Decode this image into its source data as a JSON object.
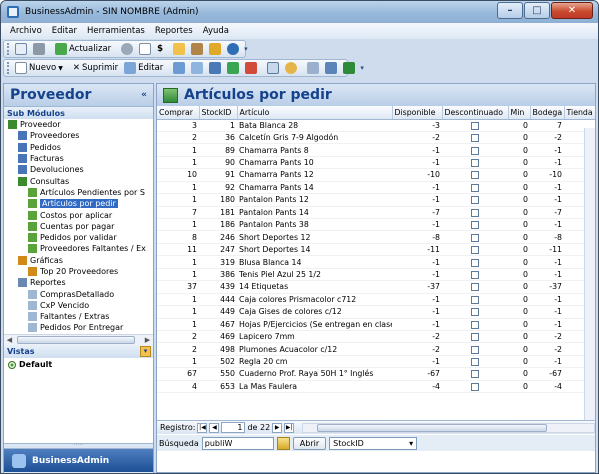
{
  "window": {
    "title": "BusinessAdmin - SIN NOMBRE (Admin)"
  },
  "menu": [
    "Archivo",
    "Editar",
    "Herramientas",
    "Reportes",
    "Ayuda"
  ],
  "toolbar1": {
    "actualizar": "Actualizar",
    "currency": "$"
  },
  "toolbar2": {
    "nuevo": "Nuevo",
    "suprimir": "Suprimir",
    "editar": "Editar"
  },
  "left": {
    "title": "Proveedor",
    "sub": "Sub Módulos",
    "tree": [
      {
        "label": "Proveedor",
        "level": 0,
        "color": "#3b8a2e"
      },
      {
        "label": "Proveedores",
        "level": 1,
        "color": "#4a74b8"
      },
      {
        "label": "Pedidos",
        "level": 1,
        "color": "#4a74b8"
      },
      {
        "label": "Facturas",
        "level": 1,
        "color": "#4a74b8"
      },
      {
        "label": "Devoluciones",
        "level": 1,
        "color": "#4a74b8"
      },
      {
        "label": "Consultas",
        "level": 1,
        "color": "#3b8a2e"
      },
      {
        "label": "Artículos Pendientes por S",
        "level": 2,
        "color": "#5aa33a"
      },
      {
        "label": "Artículos por pedir",
        "level": 2,
        "color": "#5aa33a",
        "selected": true
      },
      {
        "label": "Costos por aplicar",
        "level": 2,
        "color": "#5aa33a"
      },
      {
        "label": "Cuentas por pagar",
        "level": 2,
        "color": "#5aa33a"
      },
      {
        "label": "Pedidos por validar",
        "level": 2,
        "color": "#5aa33a"
      },
      {
        "label": "Proveedores Faltantes / Ex",
        "level": 2,
        "color": "#5aa33a"
      },
      {
        "label": "Gráficas",
        "level": 1,
        "color": "#d08a1a"
      },
      {
        "label": "Top 20 Proveedores",
        "level": 2,
        "color": "#d08a1a"
      },
      {
        "label": "Reportes",
        "level": 1,
        "color": "#6b88b0"
      },
      {
        "label": "ComprasDetallado",
        "level": 2,
        "color": "#9fb7d3"
      },
      {
        "label": "CxP Vencido",
        "level": 2,
        "color": "#9fb7d3"
      },
      {
        "label": "Faltantes / Extras",
        "level": 2,
        "color": "#9fb7d3"
      },
      {
        "label": "Pedidos Por Entregar",
        "level": 2,
        "color": "#9fb7d3"
      }
    ],
    "vistas": "Vistas",
    "vista_default": "Default",
    "nav": "BusinessAdmin"
  },
  "main": {
    "title": "Artículos por pedir",
    "columns": [
      "Comprar",
      "StockID",
      "Artículo",
      "Disponible",
      "Descontinuado",
      "Min",
      "Bodega",
      "Tienda"
    ],
    "rows": [
      [
        "3",
        "1",
        "Bata Blanca 28",
        "-3",
        "0",
        "7"
      ],
      [
        "2",
        "36",
        "Calcetín Gris 7-9 Algodón",
        "-2",
        "0",
        "-2"
      ],
      [
        "1",
        "89",
        "Chamarra Pants 8",
        "-1",
        "0",
        "-1"
      ],
      [
        "1",
        "90",
        "Chamarra Pants 10",
        "-1",
        "0",
        "-1"
      ],
      [
        "10",
        "91",
        "Chamarra Pants 12",
        "-10",
        "0",
        "-10"
      ],
      [
        "1",
        "92",
        "Chamarra Pants 14",
        "-1",
        "0",
        "-1"
      ],
      [
        "1",
        "180",
        "Pantalon Pants 12",
        "-1",
        "0",
        "-1"
      ],
      [
        "7",
        "181",
        "Pantalon Pants 14",
        "-7",
        "0",
        "-7"
      ],
      [
        "1",
        "186",
        "Pantalon Pants 38",
        "-1",
        "0",
        "-1"
      ],
      [
        "8",
        "246",
        "Short Deportes 12",
        "-8",
        "0",
        "-8"
      ],
      [
        "11",
        "247",
        "Short Deportes 14",
        "-11",
        "0",
        "-11"
      ],
      [
        "1",
        "319",
        "Blusa Blanca 14",
        "-1",
        "0",
        "-1"
      ],
      [
        "1",
        "386",
        "Tenis Piel Azul 25 1/2",
        "-1",
        "0",
        "-1"
      ],
      [
        "37",
        "439",
        "14 Etiquetas",
        "-37",
        "0",
        "-37"
      ],
      [
        "1",
        "444",
        "Caja colores Prismacolor c712",
        "-1",
        "0",
        "-1"
      ],
      [
        "1",
        "449",
        "Caja Gises de colores c/12",
        "-1",
        "0",
        "-1"
      ],
      [
        "1",
        "467",
        "Hojas P/Ejercicios (Se entregan en clase)",
        "-1",
        "0",
        "-1"
      ],
      [
        "2",
        "469",
        "Lapicero 7mm",
        "-2",
        "0",
        "-2"
      ],
      [
        "2",
        "498",
        "Plumones Acuacolor c/12",
        "-2",
        "0",
        "-2"
      ],
      [
        "1",
        "502",
        "Regla 20 cm",
        "-1",
        "0",
        "-1"
      ],
      [
        "67",
        "550",
        "Cuaderno Prof. Raya 50H 1° Inglés",
        "-67",
        "0",
        "-67"
      ],
      [
        "4",
        "653",
        "La Mas Faulera",
        "-4",
        "0",
        "-4"
      ]
    ],
    "registro": "Registro:",
    "page": "1",
    "of": "de 22",
    "busqueda": "Búsqueda",
    "search_value": "publiW",
    "abrir": "Abrir",
    "field": "StockID"
  }
}
